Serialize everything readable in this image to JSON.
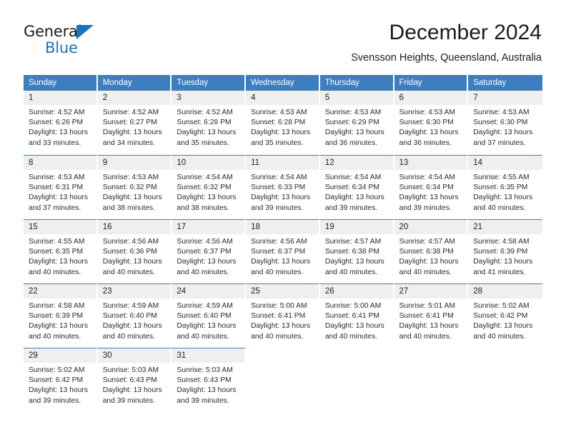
{
  "brand": {
    "name_top": "General",
    "name_bottom": "Blue",
    "accent_color": "#1a72b8"
  },
  "header": {
    "month_title": "December 2024",
    "location": "Svensson Heights, Queensland, Australia",
    "header_bg": "#3c7ebf",
    "daynum_bg": "#efefef"
  },
  "weekday_headers": [
    "Sunday",
    "Monday",
    "Tuesday",
    "Wednesday",
    "Thursday",
    "Friday",
    "Saturday"
  ],
  "weeks": [
    [
      {
        "day": "1",
        "sunrise": "Sunrise: 4:52 AM",
        "sunset": "Sunset: 6:26 PM",
        "daylight_line1": "Daylight: 13 hours",
        "daylight_line2": "and 33 minutes."
      },
      {
        "day": "2",
        "sunrise": "Sunrise: 4:52 AM",
        "sunset": "Sunset: 6:27 PM",
        "daylight_line1": "Daylight: 13 hours",
        "daylight_line2": "and 34 minutes."
      },
      {
        "day": "3",
        "sunrise": "Sunrise: 4:52 AM",
        "sunset": "Sunset: 6:28 PM",
        "daylight_line1": "Daylight: 13 hours",
        "daylight_line2": "and 35 minutes."
      },
      {
        "day": "4",
        "sunrise": "Sunrise: 4:53 AM",
        "sunset": "Sunset: 6:28 PM",
        "daylight_line1": "Daylight: 13 hours",
        "daylight_line2": "and 35 minutes."
      },
      {
        "day": "5",
        "sunrise": "Sunrise: 4:53 AM",
        "sunset": "Sunset: 6:29 PM",
        "daylight_line1": "Daylight: 13 hours",
        "daylight_line2": "and 36 minutes."
      },
      {
        "day": "6",
        "sunrise": "Sunrise: 4:53 AM",
        "sunset": "Sunset: 6:30 PM",
        "daylight_line1": "Daylight: 13 hours",
        "daylight_line2": "and 36 minutes."
      },
      {
        "day": "7",
        "sunrise": "Sunrise: 4:53 AM",
        "sunset": "Sunset: 6:30 PM",
        "daylight_line1": "Daylight: 13 hours",
        "daylight_line2": "and 37 minutes."
      }
    ],
    [
      {
        "day": "8",
        "sunrise": "Sunrise: 4:53 AM",
        "sunset": "Sunset: 6:31 PM",
        "daylight_line1": "Daylight: 13 hours",
        "daylight_line2": "and 37 minutes."
      },
      {
        "day": "9",
        "sunrise": "Sunrise: 4:53 AM",
        "sunset": "Sunset: 6:32 PM",
        "daylight_line1": "Daylight: 13 hours",
        "daylight_line2": "and 38 minutes."
      },
      {
        "day": "10",
        "sunrise": "Sunrise: 4:54 AM",
        "sunset": "Sunset: 6:32 PM",
        "daylight_line1": "Daylight: 13 hours",
        "daylight_line2": "and 38 minutes."
      },
      {
        "day": "11",
        "sunrise": "Sunrise: 4:54 AM",
        "sunset": "Sunset: 6:33 PM",
        "daylight_line1": "Daylight: 13 hours",
        "daylight_line2": "and 39 minutes."
      },
      {
        "day": "12",
        "sunrise": "Sunrise: 4:54 AM",
        "sunset": "Sunset: 6:34 PM",
        "daylight_line1": "Daylight: 13 hours",
        "daylight_line2": "and 39 minutes."
      },
      {
        "day": "13",
        "sunrise": "Sunrise: 4:54 AM",
        "sunset": "Sunset: 6:34 PM",
        "daylight_line1": "Daylight: 13 hours",
        "daylight_line2": "and 39 minutes."
      },
      {
        "day": "14",
        "sunrise": "Sunrise: 4:55 AM",
        "sunset": "Sunset: 6:35 PM",
        "daylight_line1": "Daylight: 13 hours",
        "daylight_line2": "and 40 minutes."
      }
    ],
    [
      {
        "day": "15",
        "sunrise": "Sunrise: 4:55 AM",
        "sunset": "Sunset: 6:35 PM",
        "daylight_line1": "Daylight: 13 hours",
        "daylight_line2": "and 40 minutes."
      },
      {
        "day": "16",
        "sunrise": "Sunrise: 4:56 AM",
        "sunset": "Sunset: 6:36 PM",
        "daylight_line1": "Daylight: 13 hours",
        "daylight_line2": "and 40 minutes."
      },
      {
        "day": "17",
        "sunrise": "Sunrise: 4:56 AM",
        "sunset": "Sunset: 6:37 PM",
        "daylight_line1": "Daylight: 13 hours",
        "daylight_line2": "and 40 minutes."
      },
      {
        "day": "18",
        "sunrise": "Sunrise: 4:56 AM",
        "sunset": "Sunset: 6:37 PM",
        "daylight_line1": "Daylight: 13 hours",
        "daylight_line2": "and 40 minutes."
      },
      {
        "day": "19",
        "sunrise": "Sunrise: 4:57 AM",
        "sunset": "Sunset: 6:38 PM",
        "daylight_line1": "Daylight: 13 hours",
        "daylight_line2": "and 40 minutes."
      },
      {
        "day": "20",
        "sunrise": "Sunrise: 4:57 AM",
        "sunset": "Sunset: 6:38 PM",
        "daylight_line1": "Daylight: 13 hours",
        "daylight_line2": "and 40 minutes."
      },
      {
        "day": "21",
        "sunrise": "Sunrise: 4:58 AM",
        "sunset": "Sunset: 6:39 PM",
        "daylight_line1": "Daylight: 13 hours",
        "daylight_line2": "and 41 minutes."
      }
    ],
    [
      {
        "day": "22",
        "sunrise": "Sunrise: 4:58 AM",
        "sunset": "Sunset: 6:39 PM",
        "daylight_line1": "Daylight: 13 hours",
        "daylight_line2": "and 40 minutes."
      },
      {
        "day": "23",
        "sunrise": "Sunrise: 4:59 AM",
        "sunset": "Sunset: 6:40 PM",
        "daylight_line1": "Daylight: 13 hours",
        "daylight_line2": "and 40 minutes."
      },
      {
        "day": "24",
        "sunrise": "Sunrise: 4:59 AM",
        "sunset": "Sunset: 6:40 PM",
        "daylight_line1": "Daylight: 13 hours",
        "daylight_line2": "and 40 minutes."
      },
      {
        "day": "25",
        "sunrise": "Sunrise: 5:00 AM",
        "sunset": "Sunset: 6:41 PM",
        "daylight_line1": "Daylight: 13 hours",
        "daylight_line2": "and 40 minutes."
      },
      {
        "day": "26",
        "sunrise": "Sunrise: 5:00 AM",
        "sunset": "Sunset: 6:41 PM",
        "daylight_line1": "Daylight: 13 hours",
        "daylight_line2": "and 40 minutes."
      },
      {
        "day": "27",
        "sunrise": "Sunrise: 5:01 AM",
        "sunset": "Sunset: 6:41 PM",
        "daylight_line1": "Daylight: 13 hours",
        "daylight_line2": "and 40 minutes."
      },
      {
        "day": "28",
        "sunrise": "Sunrise: 5:02 AM",
        "sunset": "Sunset: 6:42 PM",
        "daylight_line1": "Daylight: 13 hours",
        "daylight_line2": "and 40 minutes."
      }
    ],
    [
      {
        "day": "29",
        "sunrise": "Sunrise: 5:02 AM",
        "sunset": "Sunset: 6:42 PM",
        "daylight_line1": "Daylight: 13 hours",
        "daylight_line2": "and 39 minutes."
      },
      {
        "day": "30",
        "sunrise": "Sunrise: 5:03 AM",
        "sunset": "Sunset: 6:43 PM",
        "daylight_line1": "Daylight: 13 hours",
        "daylight_line2": "and 39 minutes."
      },
      {
        "day": "31",
        "sunrise": "Sunrise: 5:03 AM",
        "sunset": "Sunset: 6:43 PM",
        "daylight_line1": "Daylight: 13 hours",
        "daylight_line2": "and 39 minutes."
      },
      {
        "day": "",
        "sunrise": "",
        "sunset": "",
        "daylight_line1": "",
        "daylight_line2": ""
      },
      {
        "day": "",
        "sunrise": "",
        "sunset": "",
        "daylight_line1": "",
        "daylight_line2": ""
      },
      {
        "day": "",
        "sunrise": "",
        "sunset": "",
        "daylight_line1": "",
        "daylight_line2": ""
      },
      {
        "day": "",
        "sunrise": "",
        "sunset": "",
        "daylight_line1": "",
        "daylight_line2": ""
      }
    ]
  ]
}
